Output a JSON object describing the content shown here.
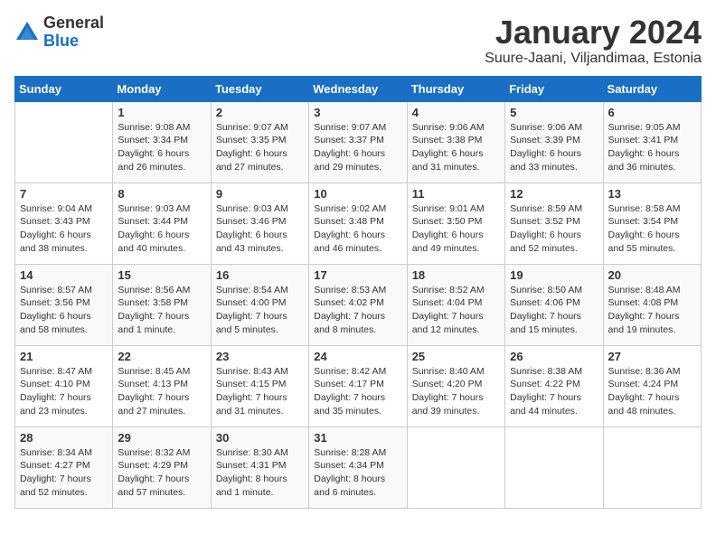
{
  "header": {
    "logo_general": "General",
    "logo_blue": "Blue",
    "title": "January 2024",
    "subtitle": "Suure-Jaani, Viljandimaa, Estonia"
  },
  "weekdays": [
    "Sunday",
    "Monday",
    "Tuesday",
    "Wednesday",
    "Thursday",
    "Friday",
    "Saturday"
  ],
  "weeks": [
    [
      {
        "day": "",
        "sunrise": "",
        "sunset": "",
        "daylight": ""
      },
      {
        "day": "1",
        "sunrise": "Sunrise: 9:08 AM",
        "sunset": "Sunset: 3:34 PM",
        "daylight": "Daylight: 6 hours and 26 minutes."
      },
      {
        "day": "2",
        "sunrise": "Sunrise: 9:07 AM",
        "sunset": "Sunset: 3:35 PM",
        "daylight": "Daylight: 6 hours and 27 minutes."
      },
      {
        "day": "3",
        "sunrise": "Sunrise: 9:07 AM",
        "sunset": "Sunset: 3:37 PM",
        "daylight": "Daylight: 6 hours and 29 minutes."
      },
      {
        "day": "4",
        "sunrise": "Sunrise: 9:06 AM",
        "sunset": "Sunset: 3:38 PM",
        "daylight": "Daylight: 6 hours and 31 minutes."
      },
      {
        "day": "5",
        "sunrise": "Sunrise: 9:06 AM",
        "sunset": "Sunset: 3:39 PM",
        "daylight": "Daylight: 6 hours and 33 minutes."
      },
      {
        "day": "6",
        "sunrise": "Sunrise: 9:05 AM",
        "sunset": "Sunset: 3:41 PM",
        "daylight": "Daylight: 6 hours and 36 minutes."
      }
    ],
    [
      {
        "day": "7",
        "sunrise": "Sunrise: 9:04 AM",
        "sunset": "Sunset: 3:43 PM",
        "daylight": "Daylight: 6 hours and 38 minutes."
      },
      {
        "day": "8",
        "sunrise": "Sunrise: 9:03 AM",
        "sunset": "Sunset: 3:44 PM",
        "daylight": "Daylight: 6 hours and 40 minutes."
      },
      {
        "day": "9",
        "sunrise": "Sunrise: 9:03 AM",
        "sunset": "Sunset: 3:46 PM",
        "daylight": "Daylight: 6 hours and 43 minutes."
      },
      {
        "day": "10",
        "sunrise": "Sunrise: 9:02 AM",
        "sunset": "Sunset: 3:48 PM",
        "daylight": "Daylight: 6 hours and 46 minutes."
      },
      {
        "day": "11",
        "sunrise": "Sunrise: 9:01 AM",
        "sunset": "Sunset: 3:50 PM",
        "daylight": "Daylight: 6 hours and 49 minutes."
      },
      {
        "day": "12",
        "sunrise": "Sunrise: 8:59 AM",
        "sunset": "Sunset: 3:52 PM",
        "daylight": "Daylight: 6 hours and 52 minutes."
      },
      {
        "day": "13",
        "sunrise": "Sunrise: 8:58 AM",
        "sunset": "Sunset: 3:54 PM",
        "daylight": "Daylight: 6 hours and 55 minutes."
      }
    ],
    [
      {
        "day": "14",
        "sunrise": "Sunrise: 8:57 AM",
        "sunset": "Sunset: 3:56 PM",
        "daylight": "Daylight: 6 hours and 58 minutes."
      },
      {
        "day": "15",
        "sunrise": "Sunrise: 8:56 AM",
        "sunset": "Sunset: 3:58 PM",
        "daylight": "Daylight: 7 hours and 1 minute."
      },
      {
        "day": "16",
        "sunrise": "Sunrise: 8:54 AM",
        "sunset": "Sunset: 4:00 PM",
        "daylight": "Daylight: 7 hours and 5 minutes."
      },
      {
        "day": "17",
        "sunrise": "Sunrise: 8:53 AM",
        "sunset": "Sunset: 4:02 PM",
        "daylight": "Daylight: 7 hours and 8 minutes."
      },
      {
        "day": "18",
        "sunrise": "Sunrise: 8:52 AM",
        "sunset": "Sunset: 4:04 PM",
        "daylight": "Daylight: 7 hours and 12 minutes."
      },
      {
        "day": "19",
        "sunrise": "Sunrise: 8:50 AM",
        "sunset": "Sunset: 4:06 PM",
        "daylight": "Daylight: 7 hours and 15 minutes."
      },
      {
        "day": "20",
        "sunrise": "Sunrise: 8:48 AM",
        "sunset": "Sunset: 4:08 PM",
        "daylight": "Daylight: 7 hours and 19 minutes."
      }
    ],
    [
      {
        "day": "21",
        "sunrise": "Sunrise: 8:47 AM",
        "sunset": "Sunset: 4:10 PM",
        "daylight": "Daylight: 7 hours and 23 minutes."
      },
      {
        "day": "22",
        "sunrise": "Sunrise: 8:45 AM",
        "sunset": "Sunset: 4:13 PM",
        "daylight": "Daylight: 7 hours and 27 minutes."
      },
      {
        "day": "23",
        "sunrise": "Sunrise: 8:43 AM",
        "sunset": "Sunset: 4:15 PM",
        "daylight": "Daylight: 7 hours and 31 minutes."
      },
      {
        "day": "24",
        "sunrise": "Sunrise: 8:42 AM",
        "sunset": "Sunset: 4:17 PM",
        "daylight": "Daylight: 7 hours and 35 minutes."
      },
      {
        "day": "25",
        "sunrise": "Sunrise: 8:40 AM",
        "sunset": "Sunset: 4:20 PM",
        "daylight": "Daylight: 7 hours and 39 minutes."
      },
      {
        "day": "26",
        "sunrise": "Sunrise: 8:38 AM",
        "sunset": "Sunset: 4:22 PM",
        "daylight": "Daylight: 7 hours and 44 minutes."
      },
      {
        "day": "27",
        "sunrise": "Sunrise: 8:36 AM",
        "sunset": "Sunset: 4:24 PM",
        "daylight": "Daylight: 7 hours and 48 minutes."
      }
    ],
    [
      {
        "day": "28",
        "sunrise": "Sunrise: 8:34 AM",
        "sunset": "Sunset: 4:27 PM",
        "daylight": "Daylight: 7 hours and 52 minutes."
      },
      {
        "day": "29",
        "sunrise": "Sunrise: 8:32 AM",
        "sunset": "Sunset: 4:29 PM",
        "daylight": "Daylight: 7 hours and 57 minutes."
      },
      {
        "day": "30",
        "sunrise": "Sunrise: 8:30 AM",
        "sunset": "Sunset: 4:31 PM",
        "daylight": "Daylight: 8 hours and 1 minute."
      },
      {
        "day": "31",
        "sunrise": "Sunrise: 8:28 AM",
        "sunset": "Sunset: 4:34 PM",
        "daylight": "Daylight: 8 hours and 6 minutes."
      },
      {
        "day": "",
        "sunrise": "",
        "sunset": "",
        "daylight": ""
      },
      {
        "day": "",
        "sunrise": "",
        "sunset": "",
        "daylight": ""
      },
      {
        "day": "",
        "sunrise": "",
        "sunset": "",
        "daylight": ""
      }
    ]
  ]
}
